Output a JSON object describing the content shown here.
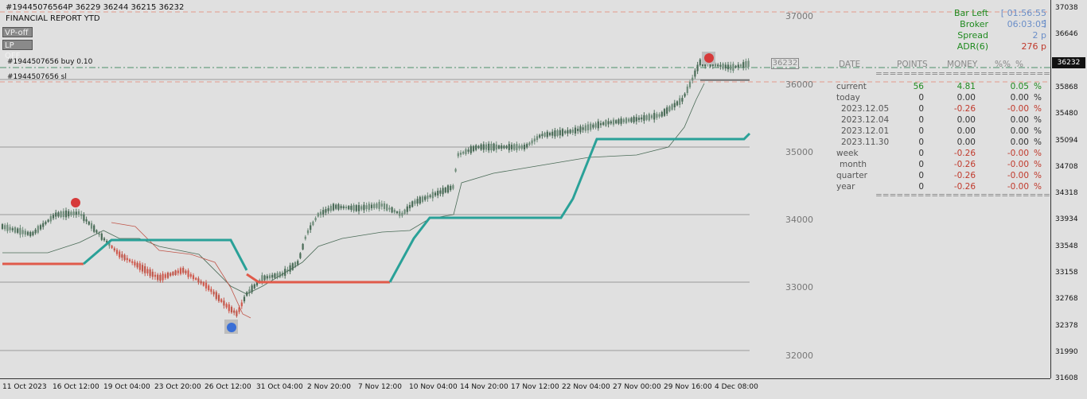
{
  "header": {
    "symbol_line": "#19445076564P 36229 36244 36215 36232",
    "report_title": "FINANCIAL REPORT YTD"
  },
  "buttons": {
    "vp": "VP-off",
    "lp": "LP OFF"
  },
  "trade_lines": {
    "buy": "#1944507656 buy 0.10",
    "sl": "#1944507656 sl",
    "price_tag": "36232"
  },
  "grid_labels": [
    "37000",
    "36000",
    "35000",
    "34000",
    "33000",
    "32000"
  ],
  "info_panel": [
    {
      "key": "Bar Left",
      "value": "[ 01:56:55 ]"
    },
    {
      "key": "Broker",
      "value": "06:03:05"
    },
    {
      "key": "Spread",
      "value": "2 p"
    },
    {
      "key": "ADR(6)",
      "value": "276 p"
    }
  ],
  "report_table": {
    "headers": [
      "DATE",
      "POINTS",
      "MONEY",
      "%%",
      "%"
    ],
    "rows": [
      {
        "label": "current",
        "points": "56",
        "money": "4.81",
        "pct": "0.05",
        "sign": "%"
      },
      {
        "label": "today",
        "points": "0",
        "money": "0.00",
        "pct": "0.00",
        "sign": "%"
      },
      {
        "label": "2023.12.05",
        "points": "0",
        "money": "-0.26",
        "pct": "-0.00",
        "sign": "%"
      },
      {
        "label": "2023.12.04",
        "points": "0",
        "money": "0.00",
        "pct": "0.00",
        "sign": "%"
      },
      {
        "label": "2023.12.01",
        "points": "0",
        "money": "0.00",
        "pct": "0.00",
        "sign": "%"
      },
      {
        "label": "2023.11.30",
        "points": "0",
        "money": "0.00",
        "pct": "0.00",
        "sign": "%"
      },
      {
        "label": "week",
        "points": "0",
        "money": "-0.26",
        "pct": "-0.00",
        "sign": "%"
      },
      {
        "label": "month",
        "points": "0",
        "money": "-0.26",
        "pct": "-0.00",
        "sign": "%"
      },
      {
        "label": "quarter",
        "points": "0",
        "money": "-0.26",
        "pct": "-0.00",
        "sign": "%"
      },
      {
        "label": "year",
        "points": "0",
        "money": "-0.26",
        "pct": "-0.00",
        "sign": "%"
      }
    ],
    "separator": "====================================="
  },
  "price_axis": [
    "37038",
    "36646",
    "36232",
    "35868",
    "35480",
    "35094",
    "34708",
    "34318",
    "33934",
    "33548",
    "33158",
    "32768",
    "32378",
    "31990",
    "31608"
  ],
  "current_price": "36232",
  "time_axis": [
    "11 Oct 2023",
    "16 Oct 12:00",
    "19 Oct 04:00",
    "23 Oct 20:00",
    "26 Oct 12:00",
    "31 Oct 04:00",
    "2 Nov 20:00",
    "7 Nov 12:00",
    "10 Nov 04:00",
    "14 Nov 20:00",
    "17 Nov 12:00",
    "22 Nov 04:00",
    "27 Nov 00:00",
    "29 Nov 16:00",
    "4 Dec 08:00"
  ],
  "colors": {
    "background": "#e0e0e0",
    "bull": "#4a6b57",
    "bear": "#d05a4e",
    "trend_up": "#2aa198",
    "trend_down": "#e05a4a",
    "money_neg": "#c0392b",
    "money_pos": "#1f8a1f"
  }
}
